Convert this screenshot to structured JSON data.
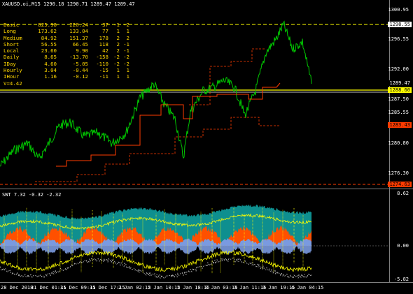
{
  "window": {
    "title": "XAUUSD.oi,M15  1290.18 1290.71 1289.47 1289.47",
    "osc_title": "SWT 7.32 -0.32 -2.32"
  },
  "price_axis": [
    "1300.95",
    "1296.55",
    "1292.00",
    "1287.50",
    "1285.55",
    "1280.80",
    "1276.30"
  ],
  "price_tags": [
    {
      "text": "1298.55",
      "bg": "#ffffff",
      "fg": "#000000"
    },
    {
      "text": "1289.47",
      "bg": "#000000",
      "fg": "#ffffff"
    },
    {
      "text": "1288.60",
      "bg": "#ffff00",
      "fg": "#000000"
    },
    {
      "text": "1283.43",
      "bg": "#ff3b00",
      "fg": "#000000"
    },
    {
      "text": "1274.63",
      "bg": "#ff3b00",
      "fg": "#000000"
    }
  ],
  "osc_axis": [
    "8.62",
    "0.00",
    "-5.82"
  ],
  "time_axis": [
    "28 Dec 2018",
    "31 Dec 01:15",
    "31 Dec 09:15",
    "31 Dec 17:15",
    "2 Jan 02:15",
    "2 Jan 10:15",
    "2 Jan 18:15",
    "3 Jan 03:15",
    "3 Jan 11:15",
    "3 Jan 19:15",
    "4 Jan 04:15"
  ],
  "stats": [
    [
      "Basic",
      "825.98",
      "220.24",
      "37",
      "-1",
      "-2"
    ],
    [
      "Long",
      "173.62",
      "133.04",
      "77",
      "1",
      "1"
    ],
    [
      "Medium",
      "84.92",
      "151.37",
      "178",
      "2",
      "2"
    ],
    [
      "Short",
      "56.55",
      "66.45",
      "118",
      "2",
      "-1"
    ],
    [
      "Local",
      "23.60",
      "9.90",
      "42",
      "2",
      "-1"
    ],
    [
      "Daily",
      "8.65",
      "-13.70",
      "-158",
      "-2",
      "-2"
    ],
    [
      "IDay",
      "4.60",
      "-5.05",
      "-110",
      "-2",
      "-2"
    ],
    [
      "Hourly",
      "3.04",
      "-0.44",
      "-15",
      "1",
      "1"
    ],
    [
      "IHour",
      "1.16",
      "-0.12",
      "-11",
      "1",
      "1"
    ]
  ],
  "stats_footer": "V=4.42",
  "colors": {
    "background": "#000000",
    "price_line": "#00c800",
    "yellow_level": "#ffff00",
    "stop_line": "#ff3b00",
    "osc_teal": "#0e8f8f",
    "osc_orange": "#ff5000",
    "osc_blue": "#7a9ae0"
  }
}
